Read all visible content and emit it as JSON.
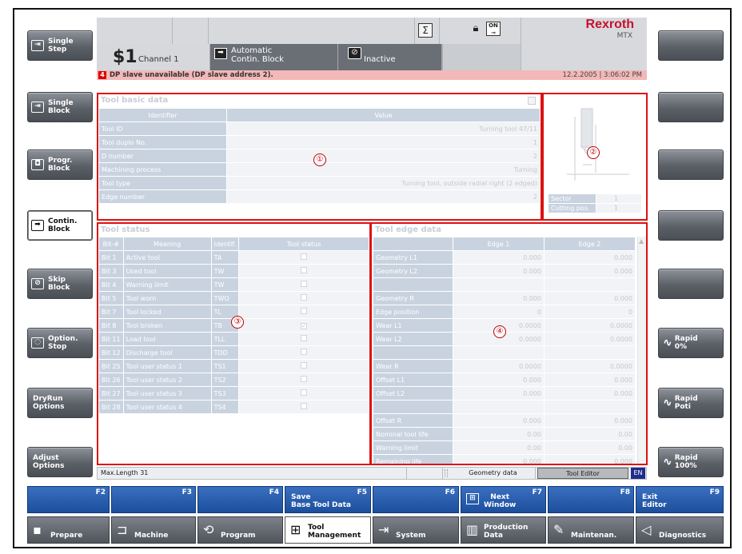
{
  "left_buttons": [
    {
      "label": "Single\nStep",
      "icon": "single-step-icon",
      "glyph": "⇥"
    },
    {
      "label": "Single\nBlock",
      "icon": "single-block-icon",
      "glyph": "⇥"
    },
    {
      "label": "Progr.\nBlock",
      "icon": "program-block-icon",
      "glyph": "◘"
    },
    {
      "label": "Contin.\nBlock",
      "icon": "continuous-block-icon",
      "glyph": "➡",
      "selected": true
    },
    {
      "label": "Skip\nBlock",
      "icon": "skip-block-icon",
      "glyph": "⊘"
    },
    {
      "label": "Option.\nStop",
      "icon": "optional-stop-icon",
      "glyph": "◌"
    },
    {
      "label": "DryRun\nOptions"
    },
    {
      "label": "Adjust\nOptions"
    }
  ],
  "right_buttons": [
    {
      "label": ""
    },
    {
      "label": ""
    },
    {
      "label": ""
    },
    {
      "label": ""
    },
    {
      "label": ""
    },
    {
      "label": "Rapid\n0%"
    },
    {
      "label": "Rapid\nPoti"
    },
    {
      "label": "Rapid\n100%"
    }
  ],
  "header": {
    "channel_prefix": "$1",
    "channel_label": "Channel 1",
    "mode_line1": "Automatic",
    "mode_line2": "Contin. Block",
    "state": "Inactive",
    "sigma": "Σ",
    "on_badge": "ON",
    "brand": "Rexroth",
    "brand_sub": "MTX"
  },
  "alarm": {
    "badge": "4",
    "message": "DP slave unavailable (DP slave address 2).",
    "datetime": "12.2.2005 | 3:06:02 PM"
  },
  "basic": {
    "title": "Tool basic data",
    "col_ident": "Identifier",
    "col_value": "Value",
    "rows": [
      {
        "label": "Tool ID",
        "value": "Turning tool 47/11"
      },
      {
        "label": "Tool duplo No.",
        "value": "1"
      },
      {
        "label": "D number",
        "value": "2"
      },
      {
        "label": "Machining process",
        "value": "Turning"
      },
      {
        "label": "Tool type",
        "value": "Turning tool, outside radial right (2 edged)"
      },
      {
        "label": "Edge number",
        "value": "2"
      }
    ]
  },
  "image_panel": {
    "rows": [
      {
        "label": "Sector",
        "value": "1"
      },
      {
        "label": "Cutting pos.",
        "value": "1"
      }
    ]
  },
  "status": {
    "title": "Tool status",
    "headers": [
      "Bit-#",
      "Meaning",
      "Identif.",
      "Tool status"
    ],
    "rows": [
      {
        "bit": "Bit 1",
        "meaning": "Active tool",
        "ident": "TA",
        "checked": false
      },
      {
        "bit": "Bit 3",
        "meaning": "Used tool",
        "ident": "TW",
        "checked": false
      },
      {
        "bit": "Bit 4",
        "meaning": "Warning limit",
        "ident": "TW",
        "checked": false
      },
      {
        "bit": "Bit 5",
        "meaning": "Tool worn",
        "ident": "TWO",
        "checked": false
      },
      {
        "bit": "Bit 7",
        "meaning": "Tool locked",
        "ident": "TL",
        "checked": false
      },
      {
        "bit": "Bit 8",
        "meaning": "Tool broken",
        "ident": "TB",
        "checked": true
      },
      {
        "bit": "Bit 11",
        "meaning": "Load tool",
        "ident": "TLL",
        "checked": false
      },
      {
        "bit": "Bit 12",
        "meaning": "Discharge tool",
        "ident": "TDD",
        "checked": false
      },
      {
        "bit": "Bit 25",
        "meaning": "Tool user status 1",
        "ident": "TS1",
        "checked": false
      },
      {
        "bit": "Bit 26",
        "meaning": "Tool user status 2",
        "ident": "TS2",
        "checked": false
      },
      {
        "bit": "Bit 27",
        "meaning": "Tool user status 3",
        "ident": "TS3",
        "checked": false
      },
      {
        "bit": "Bit 28",
        "meaning": "Tool user status 4",
        "ident": "TS4",
        "checked": false
      }
    ]
  },
  "edge": {
    "title": "Tool edge data",
    "headers": [
      "",
      "Edge 1",
      "Edge 2"
    ],
    "rows": [
      {
        "label": "Geometry L1",
        "e1": "0.000",
        "e2": "0.000"
      },
      {
        "label": "Geometry L2",
        "e1": "0.000",
        "e2": "0.000"
      },
      {
        "label": "",
        "e1": "",
        "e2": ""
      },
      {
        "label": "Geometry R",
        "e1": "0.000",
        "e2": "0.000"
      },
      {
        "label": "Edge position",
        "e1": "0",
        "e2": "0"
      },
      {
        "label": "Wear L1",
        "e1": "0.0000",
        "e2": "0.0000"
      },
      {
        "label": "Wear L2",
        "e1": "0.0000",
        "e2": "0.0000"
      },
      {
        "label": "",
        "e1": "",
        "e2": ""
      },
      {
        "label": "Wear R",
        "e1": "0.0000",
        "e2": "0.0000"
      },
      {
        "label": "Offset L1",
        "e1": "0.000",
        "e2": "0.000"
      },
      {
        "label": "Offset L2",
        "e1": "0.000",
        "e2": "0.000"
      },
      {
        "label": "",
        "e1": "",
        "e2": ""
      },
      {
        "label": "Offset R",
        "e1": "0.000",
        "e2": "0.000"
      },
      {
        "label": "Nominal tool life",
        "e1": "0.00",
        "e2": "0.00"
      },
      {
        "label": "Warning limit",
        "e1": "0.00",
        "e2": "0.00"
      },
      {
        "label": "Remaining life",
        "e1": "0.000",
        "e2": "0.000"
      }
    ]
  },
  "circles": [
    "①",
    "②",
    "③",
    "④"
  ],
  "statusbar": {
    "maxlen": "Max.Length 31",
    "mid": "Geometry data",
    "editor": "Tool Editor",
    "lang": "EN"
  },
  "fkeys": [
    {
      "fn": "F2",
      "label": ""
    },
    {
      "fn": "F3",
      "label": ""
    },
    {
      "fn": "F4",
      "label": ""
    },
    {
      "fn": "F5",
      "label": "Save\nBase Tool Data"
    },
    {
      "fn": "F6",
      "label": ""
    },
    {
      "fn": "F7",
      "label": "Next\nWindow"
    },
    {
      "fn": "F8",
      "label": ""
    },
    {
      "fn": "F9",
      "label": "Exit\nEditor"
    }
  ],
  "areas": [
    {
      "label": "Prepare",
      "glyph": "▪"
    },
    {
      "label": "Machine",
      "glyph": "⊐"
    },
    {
      "label": "Program",
      "glyph": "⟲"
    },
    {
      "label": "Tool\nManagement",
      "glyph": "⊞"
    },
    {
      "label": "System",
      "glyph": "⇥"
    },
    {
      "label": "Production\nData",
      "glyph": "▥"
    },
    {
      "label": "Maintenan.",
      "glyph": "✎"
    },
    {
      "label": "Diagnostics",
      "glyph": "◁"
    }
  ],
  "colors": {
    "accent_blue": "#1f57a8",
    "alarm_bg": "#f3b8b8",
    "highlight_red": "#dd1111",
    "brand_red": "#c8102e"
  }
}
